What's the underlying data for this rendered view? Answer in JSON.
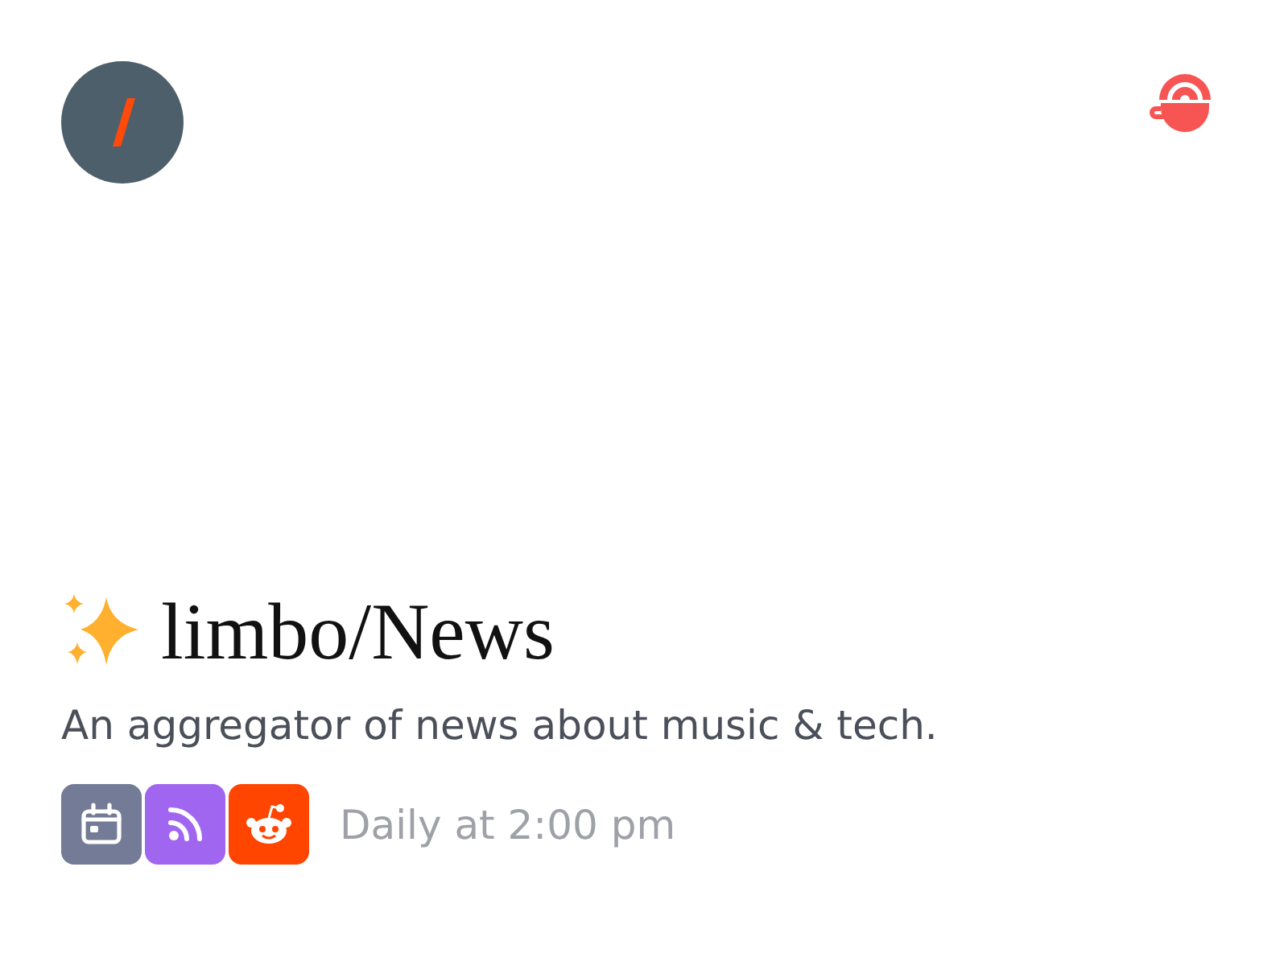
{
  "title": "limbo/News",
  "description": "An aggregator of news about music & tech.",
  "sources": [
    {
      "kind": "calendar",
      "color": "#737b96"
    },
    {
      "kind": "rss",
      "color": "#a066f0"
    },
    {
      "kind": "reddit",
      "color": "#ff4500"
    }
  ],
  "schedule": "Daily at 2:00 pm"
}
